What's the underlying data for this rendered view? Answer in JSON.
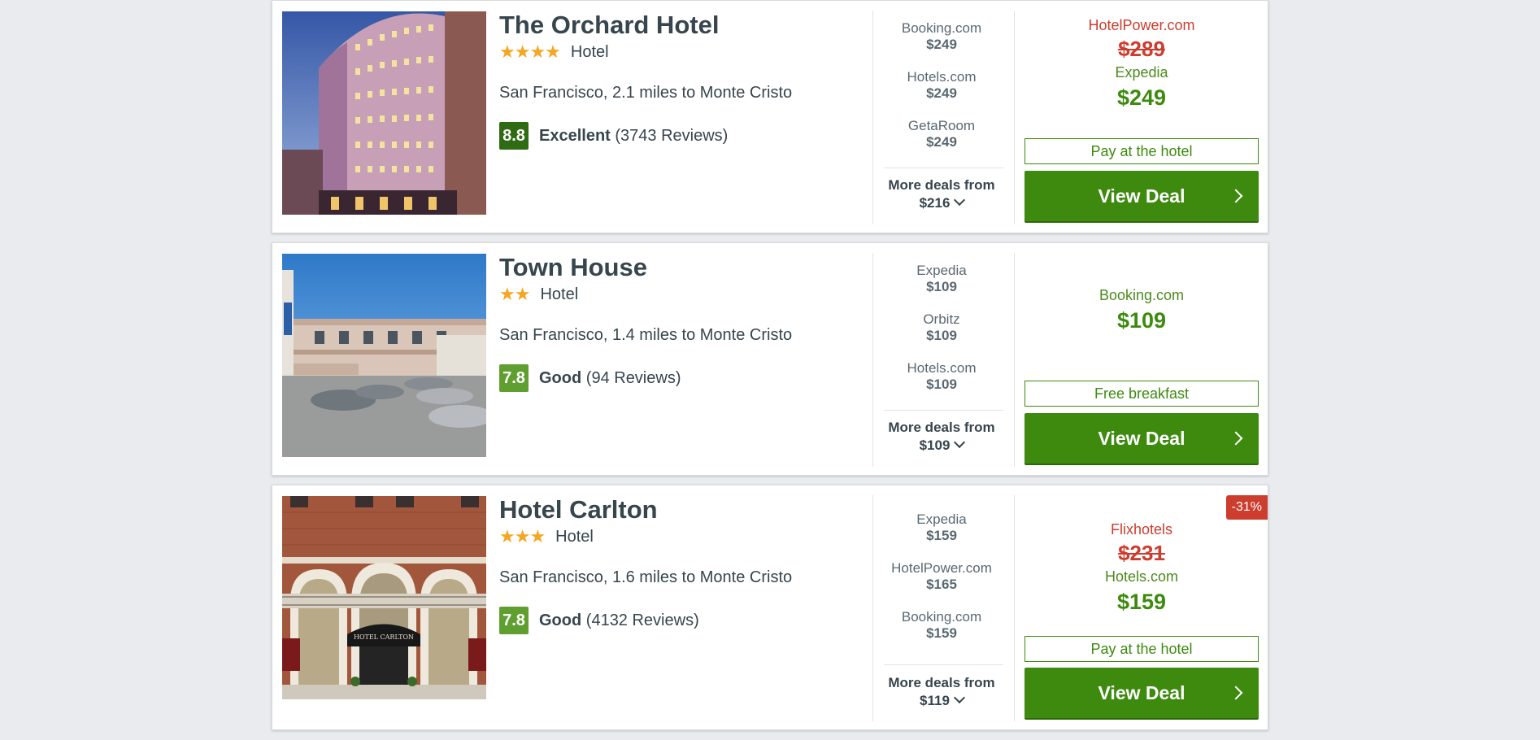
{
  "hotels": [
    {
      "name": "The Orchard Hotel",
      "stars": "★★★★",
      "type": "Hotel",
      "location": "San Francisco, 2.1 miles to Monte Cristo",
      "score": "8.8",
      "rating_word": "Excellent",
      "reviews": "(3743 Reviews)",
      "providers": [
        {
          "name": "Booking.com",
          "price": "$249"
        },
        {
          "name": "Hotels.com",
          "price": "$249"
        },
        {
          "name": "GetaRoom",
          "price": "$249"
        }
      ],
      "more_label": "More deals from",
      "more_price": "$216",
      "strike_source": "HotelPower.com",
      "strike_price": "$289",
      "deal_source": "Expedia",
      "deal_price": "$249",
      "tag": "Pay at the hotel",
      "button": "View Deal"
    },
    {
      "name": "Town House",
      "stars": "★★",
      "type": "Hotel",
      "location": "San Francisco, 1.4 miles to Monte Cristo",
      "score": "7.8",
      "rating_word": "Good",
      "reviews": "(94 Reviews)",
      "providers": [
        {
          "name": "Expedia",
          "price": "$109"
        },
        {
          "name": "Orbitz",
          "price": "$109"
        },
        {
          "name": "Hotels.com",
          "price": "$109"
        }
      ],
      "more_label": "More deals from",
      "more_price": "$109",
      "deal_source": "Booking.com",
      "deal_price": "$109",
      "tag": "Free breakfast",
      "button": "View Deal"
    },
    {
      "name": "Hotel Carlton",
      "stars": "★★★",
      "type": "Hotel",
      "location": "San Francisco, 1.6 miles to Monte Cristo",
      "score": "7.8",
      "rating_word": "Good",
      "reviews": "(4132 Reviews)",
      "providers": [
        {
          "name": "Expedia",
          "price": "$159"
        },
        {
          "name": "HotelPower.com",
          "price": "$165"
        },
        {
          "name": "Booking.com",
          "price": "$159"
        }
      ],
      "more_label": "More deals from",
      "more_price": "$119",
      "strike_source": "Flixhotels",
      "strike_price": "$231",
      "deal_source": "Hotels.com",
      "deal_price": "$159",
      "tag": "Pay at the hotel",
      "button": "View Deal",
      "discount_badge": "-31%",
      "photo_sign": "HOTEL CARLTON"
    }
  ],
  "colors": {
    "deal_green": "#3d8a0f",
    "strike_red": "#cc3d2e",
    "star_orange": "#f5a623",
    "score_dark": "#2f6b12",
    "score_light": "#5e9f30"
  }
}
